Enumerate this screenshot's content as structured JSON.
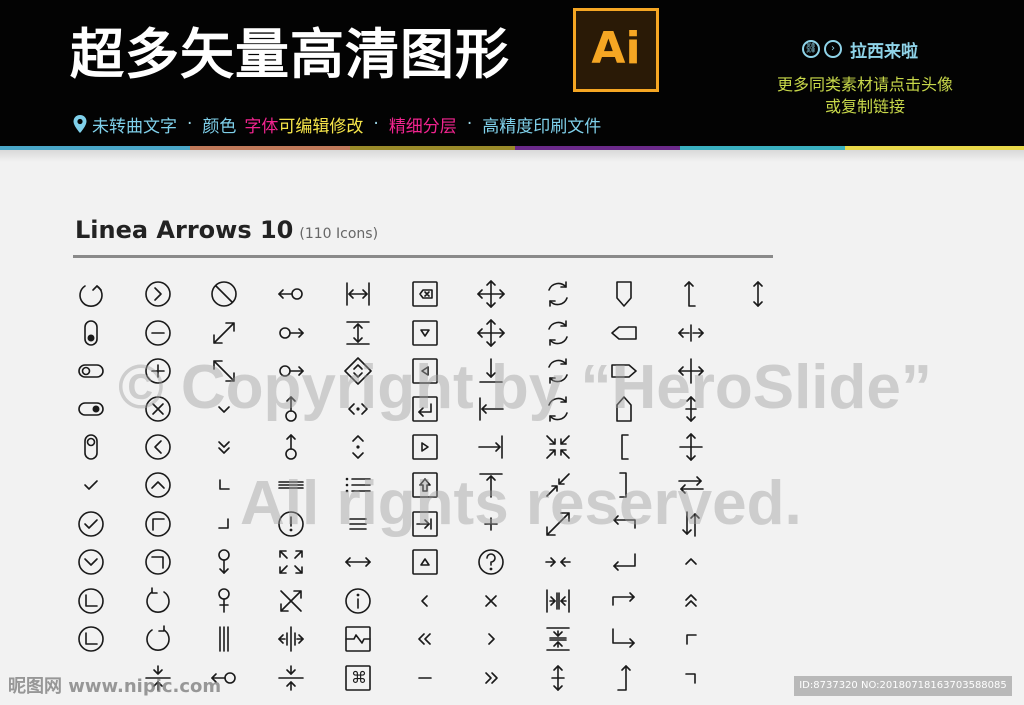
{
  "banner": {
    "title": "超多矢量高清图形",
    "logo_text": "Ai",
    "brand_name": "拉西来啦",
    "promo_line1": "更多同类素材请点击头像",
    "promo_line2": "或复制链接",
    "features": [
      {
        "text": "未转曲文字",
        "color": "#7fd0ea"
      },
      {
        "text": "颜色",
        "color": "#7fd0ea"
      },
      {
        "text": "字体",
        "color": "#f2248f"
      },
      {
        "text": "可编辑修改",
        "color": "#f7e64a"
      },
      {
        "text": "精细分层",
        "color": "#f2248f"
      },
      {
        "text": "高精度印刷文件",
        "color": "#7fd0ea"
      }
    ],
    "separator": "·",
    "stripe_colors": [
      "#4aa7c8",
      "#c07a5a",
      "#9a8a2a",
      "#6b2a8a",
      "#3ab0c0",
      "#e8d84a"
    ]
  },
  "section": {
    "title": "Linea Arrows 10",
    "count": "(110 Icons)"
  },
  "watermarks": {
    "copyright": "© Copyright by “HeroSlide”",
    "rights": "All rights reserved.",
    "site": "昵图网 www.nipic.com",
    "id_line": "ID:8737320 NO:20180718163703588085"
  },
  "icon_columns": [
    [
      "rotate-ccw-icon",
      "toggle-vertical-icon",
      "toggle-off-icon",
      "toggle-on-icon",
      "toggle-vertical-on-icon",
      "check-small-icon",
      "check-circle-icon",
      "chevron-down-circle-icon",
      "corner-circle-icon",
      "corner-alt-circle-icon"
    ],
    [
      "chevron-right-circle-icon",
      "minus-circle-icon",
      "plus-circle-icon",
      "x-circle-icon",
      "chevron-left-circle-icon",
      "chevron-up-circle-icon",
      "corner-ur-circle-icon",
      "corner-ul-circle-icon",
      "rotate-ccw-alt-icon",
      "rotate-cw-icon",
      "compress-icon"
    ],
    [
      "ban-icon",
      "diagonal-expand-icon",
      "diagonal-shrink-icon",
      "chevron-down-icon",
      "double-chevron-down-icon",
      "corner-bl-icon",
      "corner-br-icon",
      "pin-down-icon",
      "pin-down-alt-icon",
      "vertical-lines-icon",
      "line-left-circle-icon"
    ],
    [
      "line-circle-left-icon",
      "line-circle-right-icon",
      "line-circle-right-alt-icon",
      "circle-arrow-up-icon",
      "circle-arrow-up-alt-icon",
      "double-lines-icon",
      "exclamation-circle-icon",
      "expand-corners-icon",
      "cross-arrows-icon",
      "split-horizontal-icon",
      "merge-vertical-icon"
    ],
    [
      "width-icon",
      "height-icon",
      "diamond-arrows-icon",
      "inward-horizontal-icon",
      "diamond-vertical-icon",
      "list-icon",
      "menu-lines-icon",
      "double-arrow-horizontal-icon",
      "info-circle-icon",
      "collapse-square-icon",
      "command-square-icon"
    ],
    [
      "backspace-square-icon",
      "triangle-down-square-icon",
      "triangle-left-square-icon",
      "return-square-icon",
      "triangle-right-square-icon",
      "arrow-up-square-icon",
      "tab-right-square-icon",
      "triangle-up-square-icon",
      "chevron-left-icon",
      "double-chevron-left-icon",
      "minus-icon"
    ],
    [
      "move-icon",
      "move-alt-icon",
      "arrow-down-line-icon",
      "arrow-left-line-icon",
      "arrow-right-line-icon",
      "arrow-up-line-icon",
      "plus-icon",
      "question-circle-icon",
      "x-icon",
      "chevron-right-icon",
      "double-chevron-right-icon"
    ],
    [
      "refresh-icon",
      "refresh-alt-icon",
      "refresh-alt2-icon",
      "refresh-alt3-icon",
      "shrink-icon",
      "diagonal-in-icon",
      "diagonal-out-icon",
      "inward-arrows-icon",
      "width-in-icon",
      "height-in-icon",
      "arrow-up-down-small-icon"
    ],
    [
      "tag-down-icon",
      "tag-left-icon",
      "tag-right-icon",
      "tag-up-icon",
      "corner-up-left-icon",
      "corner-down-left-icon",
      "arrow-turn-left-icon",
      "return-left-icon",
      "arrow-turn-right-icon",
      "arrow-down-right-icon",
      "arrow-up-curve-icon"
    ],
    [
      "arrow-up-bracket-icon",
      "horizontal-expand-icon",
      "plus-arrows-icon",
      "vertical-expand-icon",
      "vertical-plus-icon",
      "swap-horizontal-icon",
      "swap-vertical-icon",
      "chevron-up-icon",
      "double-chevron-up-icon",
      "corner-tl-icon",
      "corner-tr-icon"
    ],
    [
      "up-down-arrow-icon"
    ]
  ]
}
